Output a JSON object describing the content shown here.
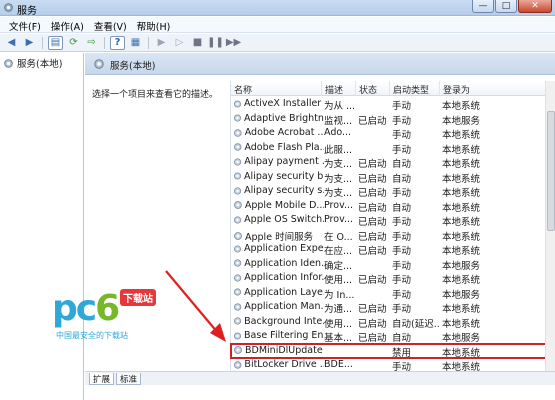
{
  "window": {
    "title": "服务",
    "btn_min": "—",
    "btn_max": "□",
    "btn_close": "✕"
  },
  "menu": [
    "文件(F)",
    "操作(A)",
    "查看(V)",
    "帮助(H)"
  ],
  "toolbar": {
    "icons": [
      "back-arrow-icon",
      "forward-arrow-icon",
      "show-hide-tree-icon",
      "refresh-icon",
      "export-icon",
      "help-icon",
      "properties-icon",
      "start-icon",
      "start-alt-icon",
      "stop-icon",
      "pause-icon",
      "restart-icon"
    ]
  },
  "tree": {
    "root_label": "服务(本地)"
  },
  "panel": {
    "title": "服务(本地)",
    "description_prompt": "选择一个项目来查看它的描述。"
  },
  "columns": {
    "name": "名称",
    "desc": "描述",
    "state": "状态",
    "startup": "启动类型",
    "logon": "登录为"
  },
  "services": [
    {
      "name": "ActiveX Installer ...",
      "desc": "为从 ...",
      "state": "",
      "startup": "手动",
      "logon": "本地系统"
    },
    {
      "name": "Adaptive Brightn...",
      "desc": "监视...",
      "state": "已启动",
      "startup": "手动",
      "logon": "本地服务"
    },
    {
      "name": "Adobe Acrobat ...",
      "desc": "Ado...",
      "state": "",
      "startup": "手动",
      "logon": "本地系统"
    },
    {
      "name": "Adobe Flash Pla...",
      "desc": "此服...",
      "state": "",
      "startup": "手动",
      "logon": "本地系统"
    },
    {
      "name": "Alipay payment ...",
      "desc": "为支...",
      "state": "已启动",
      "startup": "自动",
      "logon": "本地系统"
    },
    {
      "name": "Alipay security b...",
      "desc": "为支...",
      "state": "已启动",
      "startup": "自动",
      "logon": "本地系统"
    },
    {
      "name": "Alipay security s...",
      "desc": "为支...",
      "state": "已启动",
      "startup": "手动",
      "logon": "本地系统"
    },
    {
      "name": "Apple Mobile D...",
      "desc": "Prov...",
      "state": "已启动",
      "startup": "自动",
      "logon": "本地系统"
    },
    {
      "name": "Apple OS Switch...",
      "desc": "Prov...",
      "state": "已启动",
      "startup": "手动",
      "logon": "本地系统"
    },
    {
      "name": "Apple 时间服务",
      "desc": "在 O...",
      "state": "已启动",
      "startup": "手动",
      "logon": "本地系统"
    },
    {
      "name": "Application Expe...",
      "desc": "在应...",
      "state": "已启动",
      "startup": "手动",
      "logon": "本地系统"
    },
    {
      "name": "Application Iden...",
      "desc": "确定...",
      "state": "",
      "startup": "手动",
      "logon": "本地服务"
    },
    {
      "name": "Application Infor...",
      "desc": "使用...",
      "state": "已启动",
      "startup": "手动",
      "logon": "本地系统"
    },
    {
      "name": "Application Laye...",
      "desc": "为 In...",
      "state": "",
      "startup": "手动",
      "logon": "本地服务"
    },
    {
      "name": "Application Man...",
      "desc": "为通...",
      "state": "已启动",
      "startup": "手动",
      "logon": "本地系统"
    },
    {
      "name": "Background Inte...",
      "desc": "使用...",
      "state": "已启动",
      "startup": "自动(延迟...",
      "logon": "本地系统"
    },
    {
      "name": "Base Filtering En...",
      "desc": "基本...",
      "state": "已启动",
      "startup": "自动",
      "logon": "本地服务"
    },
    {
      "name": "BDMiniDlUpdate",
      "desc": "",
      "state": "",
      "startup": "禁用",
      "logon": "本地系统",
      "highlighted": true
    },
    {
      "name": "BitLocker Drive ...",
      "desc": "BDE...",
      "state": "",
      "startup": "手动",
      "logon": "本地系统"
    }
  ],
  "tabs": [
    "扩展",
    "标准"
  ],
  "watermark": {
    "brand": "pc",
    "brand_num": "6",
    "tag": "下载站",
    "subtitle": "中国最安全的下载站"
  },
  "colors": {
    "highlight": "#d0212a",
    "arrow": "#e02020"
  }
}
